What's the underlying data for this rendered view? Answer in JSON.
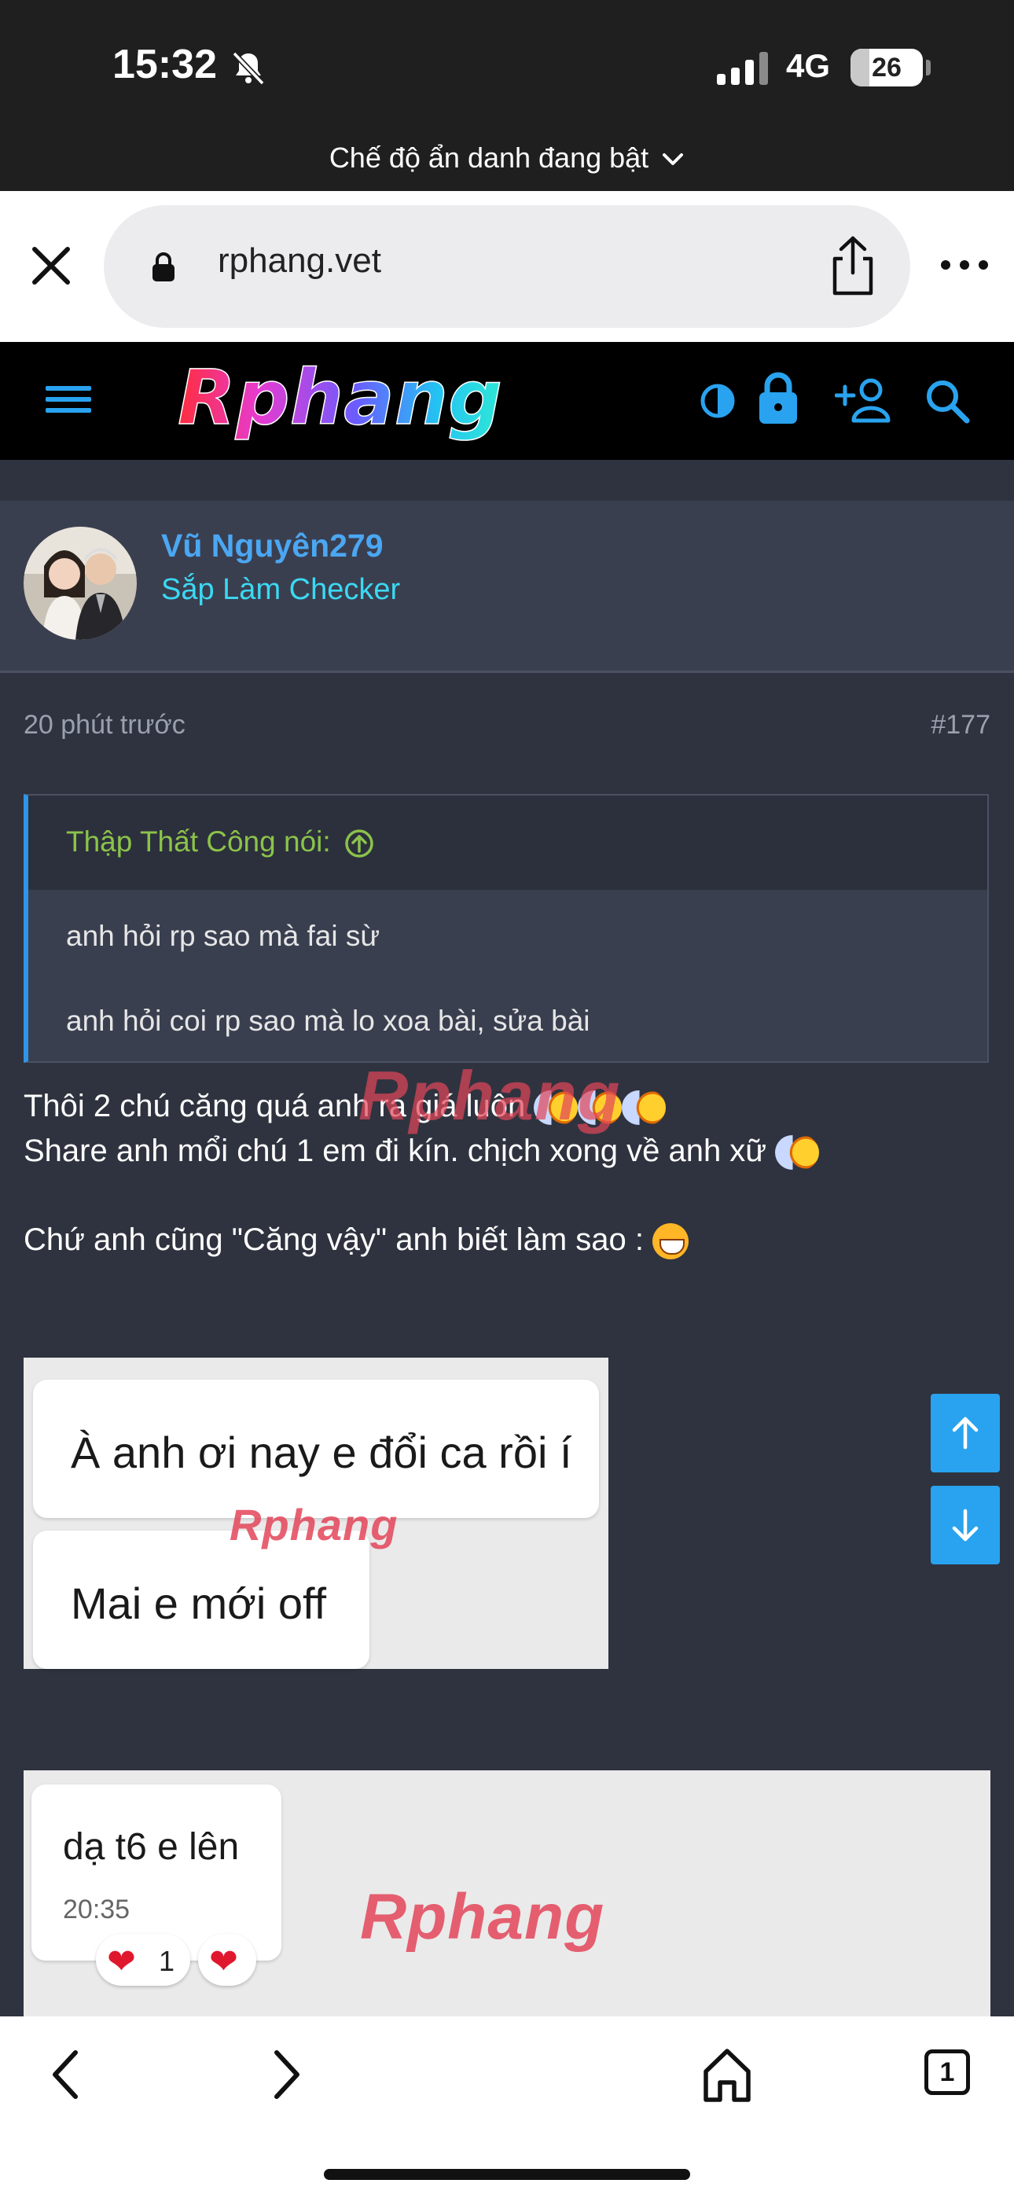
{
  "status_bar": {
    "time": "15:32",
    "network": "4G",
    "battery": "26",
    "battery_level": 0.26
  },
  "incognito_label": "Chế độ ẩn danh đang bật",
  "browser": {
    "url": "rphang.vet"
  },
  "site": {
    "logo_text": "Rphang"
  },
  "post": {
    "username": "Vũ Nguyên279",
    "user_title": "Sắp Làm Checker",
    "time_ago": "20 phút trước",
    "post_number": "#177",
    "quote": {
      "author": "Thập Thất Công nói:",
      "lines": [
        "anh hỏi rp sao mà fai sừ",
        "anh hỏi coi rp sao mà lo xoa bài, sửa bài"
      ]
    },
    "body_lines": [
      "Thôi 2 chú căng quá anh ra giá luôn",
      "Share anh mổi chú 1 em đi kín. chịch xong về anh xữ",
      "Chứ anh cũng \"Căng vậy\" anh biết làm sao :"
    ],
    "image1": {
      "bubbles": [
        "À anh ơi nay e đổi ca rồi í",
        "Mai e mới off"
      ]
    },
    "image2": {
      "bubble_text": "dạ t6 e lên",
      "bubble_time": "20:35",
      "reaction_count": "1"
    }
  }
}
